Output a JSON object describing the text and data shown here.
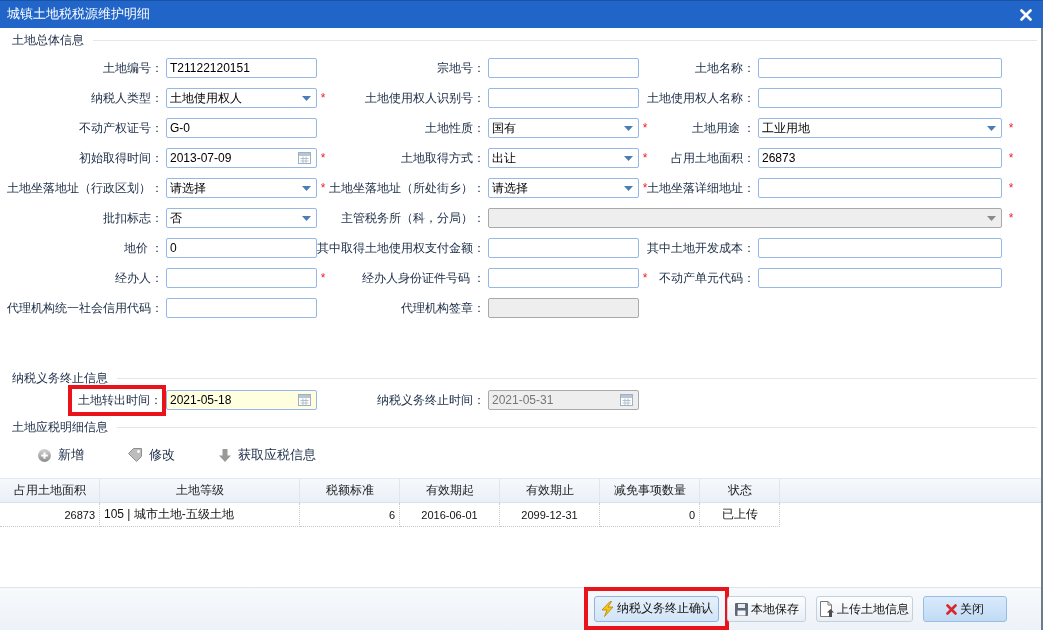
{
  "window": {
    "title": "城镇土地税税源维护明细"
  },
  "sections": [
    {
      "kind": "form",
      "title": "土地总体信息",
      "rows": [
        [
          {
            "label": "土地编号：",
            "kind": "text",
            "value": "T21122120151",
            "disabled": false,
            "focused": false,
            "highlighted": false
          },
          {
            "label": "宗地号：",
            "kind": "text",
            "disabled": false,
            "focused": false,
            "highlighted": false
          },
          {
            "label": "土地名称：",
            "kind": "text",
            "disabled": false,
            "focused": false,
            "highlighted": false
          }
        ],
        [
          {
            "label": "纳税人类型：",
            "kind": "select",
            "value": "土地使用权人",
            "mark": "*",
            "disabled": false,
            "focused": false,
            "highlighted": false
          },
          {
            "label": "土地使用权人识别号：",
            "kind": "text",
            "disabled": false,
            "focused": false,
            "highlighted": false
          },
          {
            "label": "土地使用权人名称：",
            "kind": "text",
            "disabled": false,
            "focused": false,
            "highlighted": false
          }
        ],
        [
          {
            "label": "不动产权证号：",
            "kind": "text",
            "value": "G-0",
            "disabled": false,
            "focused": false,
            "highlighted": false
          },
          {
            "label": "土地性质：",
            "kind": "select",
            "value": "国有",
            "mark": "*",
            "disabled": false,
            "focused": false,
            "highlighted": false
          },
          {
            "label": "土地用途 ：",
            "kind": "select",
            "value": "工业用地",
            "mark": "*",
            "disabled": false,
            "focused": false,
            "highlighted": false
          }
        ],
        [
          {
            "label": "初始取得时间：",
            "kind": "date",
            "value": "2013-07-09",
            "mark": "*",
            "disabled": false,
            "focused": false,
            "highlighted": false
          },
          {
            "label": "土地取得方式：",
            "kind": "select",
            "value": "出让",
            "mark": "*",
            "disabled": false,
            "focused": false,
            "highlighted": false
          },
          {
            "label": "占用土地面积：",
            "kind": "text",
            "value": "26873",
            "mark": "*",
            "disabled": false,
            "focused": false,
            "highlighted": false
          }
        ],
        [
          {
            "label": "土地坐落地址（行政区划）：",
            "kind": "select",
            "value": "请选择",
            "mark": "*",
            "disabled": false,
            "focused": false,
            "highlighted": false
          },
          {
            "label": "土地坐落地址（所处街乡）：",
            "kind": "select",
            "value": "请选择",
            "mark": "*",
            "disabled": false,
            "focused": false,
            "highlighted": false
          },
          {
            "label": "土地坐落详细地址：",
            "kind": "text",
            "mark": "*",
            "disabled": false,
            "focused": false,
            "highlighted": false
          }
        ],
        [
          {
            "label": "批扣标志：",
            "kind": "select",
            "value": "否",
            "disabled": false,
            "focused": false,
            "highlighted": false
          },
          {
            "label": "主管税务所（科，分局）：",
            "kind": "wide-select",
            "mark": "*",
            "disabled": true,
            "focused": false,
            "highlighted": false
          }
        ],
        [
          {
            "label": "地价 ：",
            "kind": "text",
            "value": "0",
            "disabled": false,
            "focused": false,
            "highlighted": false
          },
          {
            "label": "其中取得土地使用权支付金额：",
            "kind": "text",
            "disabled": false,
            "focused": false,
            "highlighted": false
          },
          {
            "label": "其中土地开发成本：",
            "kind": "text",
            "disabled": false,
            "focused": false,
            "highlighted": false
          }
        ],
        [
          {
            "label": "经办人：",
            "kind": "text",
            "mark": "*",
            "disabled": false,
            "focused": false,
            "highlighted": false
          },
          {
            "label": "经办人身份证件号码 ：",
            "kind": "text",
            "mark": "*",
            "disabled": false,
            "focused": false,
            "highlighted": false
          },
          {
            "label": "不动产单元代码：",
            "kind": "text",
            "disabled": false,
            "focused": false,
            "highlighted": false
          }
        ],
        [
          {
            "label": "代理机构统一社会信用代码：",
            "kind": "text",
            "disabled": false,
            "focused": false,
            "highlighted": false
          },
          {
            "label": "代理机构签章：",
            "kind": "text",
            "disabled": true,
            "focused": false,
            "highlighted": false
          }
        ]
      ]
    },
    {
      "kind": "form",
      "title": "纳税义务终止信息",
      "rows": [
        [
          {
            "label": "土地转出时间：",
            "kind": "date",
            "value": "2021-05-18",
            "disabled": false,
            "focused": true,
            "highlighted": true
          },
          {
            "label": "纳税义务终止时间：",
            "kind": "date",
            "value": "2021-05-31",
            "disabled": true,
            "focused": false,
            "highlighted": false
          }
        ]
      ]
    },
    {
      "kind": "grid",
      "title": "土地应税明细信息",
      "toolbar": [
        {
          "kind": "add",
          "label": "新增"
        },
        {
          "kind": "edit",
          "label": "修改"
        },
        {
          "kind": "fetch",
          "label": "获取应税信息"
        }
      ],
      "table": {
        "columns": [
          "占用土地面积",
          "土地等级",
          "税额标准",
          "有效期起",
          "有效期止",
          "减免事项数量",
          "状态"
        ],
        "rows": [
          {
            "cells": [
              "26873",
              "105 | 城市土地-五级土地",
              "6",
              "2016-06-01",
              "2099-12-31",
              "0",
              "已上传"
            ]
          }
        ]
      }
    }
  ],
  "footer": {
    "buttons": [
      {
        "kind": "confirm",
        "label": "纳税义务终止确认",
        "highlighted": true
      },
      {
        "kind": "save",
        "label": "本地保存",
        "highlighted": false
      },
      {
        "kind": "upload",
        "label": "上传土地信息",
        "highlighted": false
      },
      {
        "kind": "close",
        "label": "关闭",
        "highlighted": false
      }
    ]
  }
}
